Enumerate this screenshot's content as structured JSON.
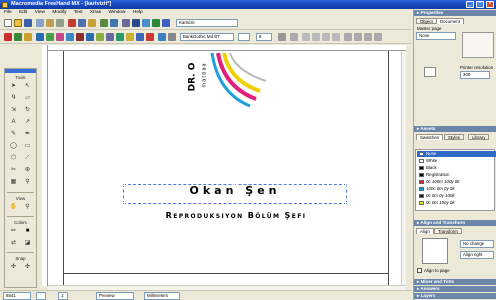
{
  "window": {
    "title": "Macromedia FreeHand MX - [kartvizit*]"
  },
  "menu": [
    "File",
    "Edit",
    "View",
    "Modify",
    "Text",
    "Xtras",
    "Window",
    "Help"
  ],
  "toolbar": {
    "style_field": "Kartvizit",
    "font_field": "BankGothic Md BT",
    "size_field": "8"
  },
  "tools": {
    "tools_label": "Tools",
    "view_label": "View",
    "colors_label": "Colors",
    "snap_label": "Snap"
  },
  "canvas": {
    "logo_text": "DR. O",
    "logo_sub": "matbaa",
    "name_line": "Okan Şen",
    "dept_line": "Reproduksiyon Bölüm Şefi"
  },
  "status": {
    "zoom": "8541",
    "page_num": "1",
    "display_mode": "Preview",
    "units": "Millimeters"
  },
  "panel": {
    "properties_title": "▸ Properties",
    "tabs": [
      "Object",
      "Document"
    ],
    "master_label": "Master page",
    "master_value": "None",
    "printer_res_label": "Printer resolution",
    "printer_res_value": "300",
    "assets_title": "▸ Assets",
    "assets_tabs": [
      "Swatches",
      "Styles",
      "Library"
    ],
    "swatches": [
      {
        "name": "None",
        "color": "#ffffff",
        "selected": true
      },
      {
        "name": "White",
        "color": "#ffffff"
      },
      {
        "name": "Black",
        "color": "#000000"
      },
      {
        "name": "Registration",
        "color": "#000000"
      },
      {
        "name": "0c 100m 100y 0k",
        "color": "#e0201b"
      },
      {
        "name": "100c 0m 0y 0k",
        "color": "#00a0e0"
      },
      {
        "name": "0c 0m 0y 100k",
        "color": "#1a1a1a"
      },
      {
        "name": "0c 0m 100y 0k",
        "color": "#f6e400"
      }
    ],
    "align_title": "▸ Align and Transform",
    "align_tabs": [
      "Align",
      "Transform"
    ],
    "align_h": "No change",
    "align_v": "Align right",
    "align_page_label": "Align to page",
    "mixer_title": "▸ Mixer and Tints",
    "answers_title": "▸ Answers",
    "layers_title": "▸ Layers"
  }
}
